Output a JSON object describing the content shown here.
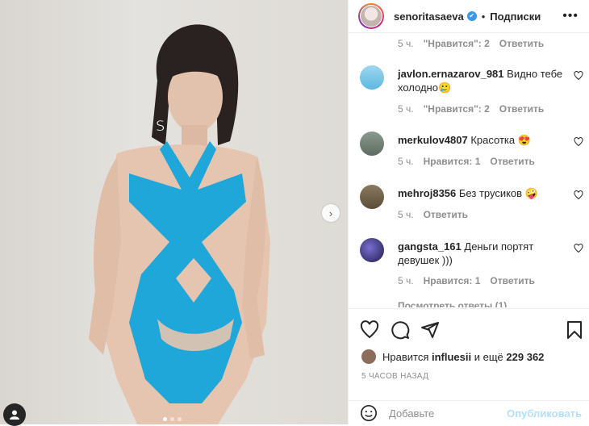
{
  "header": {
    "username": "senoritasaeva",
    "follow_label": "Подписки",
    "separator": "•",
    "more_label": "•••"
  },
  "top_meta": {
    "time": "5 ч.",
    "likes": "\"Нравится\": 2",
    "reply": "Ответить"
  },
  "comments": [
    {
      "user": "javlon.ernazarov_981",
      "text": "Видно тебе холодно🥲",
      "time": "5 ч.",
      "likes": "\"Нравится\": 2",
      "reply": "Ответить"
    },
    {
      "user": "merkulov4807",
      "text": "Красотка 😍",
      "time": "5 ч.",
      "likes": "Нравится: 1",
      "reply": "Ответить"
    },
    {
      "user": "mehroj8356",
      "text": "Без трусиков 🤪",
      "time": "5 ч.",
      "reply": "Ответить"
    },
    {
      "user": "gangsta_161",
      "text": "Деньги портят девушек )))",
      "time": "5 ч.",
      "likes": "Нравится: 1",
      "reply": "Ответить"
    }
  ],
  "replies_partial": "Посмотреть ответы (1)",
  "likes_line": {
    "prefix": "Нравится",
    "user": "influesii",
    "mid": "и ещё",
    "count": "229 362"
  },
  "timestamp": "5 ЧАСОВ НАЗАД",
  "add_comment": {
    "placeholder": "Добавьте",
    "post_label": "Опубликовать"
  },
  "carousel": {
    "next_label": "›",
    "slides": 3,
    "active": 1
  },
  "colors": {
    "swimsuit": "#1ea7d8",
    "link_blue": "#b2dffc",
    "verified": "#3897f0"
  }
}
